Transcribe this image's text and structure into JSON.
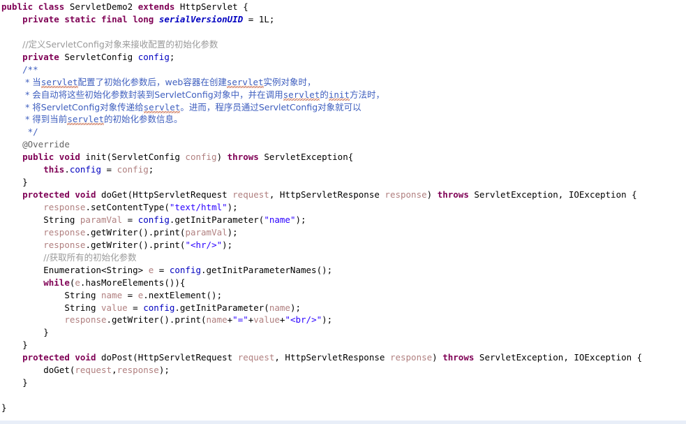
{
  "editor": {
    "language": "Java",
    "class_name": "ServletDemo2",
    "background_color": "#ffffff",
    "bottom_band_color": "#e8eef8",
    "colors": {
      "keyword": "#7f0055",
      "string": "#2a00ff",
      "line_comment": "#9a9a9a",
      "javadoc": "#3f5fbf",
      "field": "#0000c0",
      "local_variable": "#b07f7f",
      "annotation": "#646464",
      "plain_text": "#000000",
      "spellcheck_squiggle": "#c0502a"
    },
    "lines": [
      {
        "n": 1,
        "indent": 0,
        "tokens": [
          {
            "t": "public",
            "c": "kw"
          },
          {
            "t": " ",
            "c": "plain"
          },
          {
            "t": "class",
            "c": "kw"
          },
          {
            "t": " ServletDemo2 ",
            "c": "plain"
          },
          {
            "t": "extends",
            "c": "kw"
          },
          {
            "t": " HttpServlet {",
            "c": "plain"
          }
        ]
      },
      {
        "n": 2,
        "indent": 1,
        "tokens": [
          {
            "t": "private",
            "c": "kw"
          },
          {
            "t": " ",
            "c": "plain"
          },
          {
            "t": "static",
            "c": "kw"
          },
          {
            "t": " ",
            "c": "plain"
          },
          {
            "t": "final",
            "c": "kw"
          },
          {
            "t": " ",
            "c": "plain"
          },
          {
            "t": "long",
            "c": "kw"
          },
          {
            "t": " ",
            "c": "plain"
          },
          {
            "t": "serialVersionUID",
            "c": "fielditalic"
          },
          {
            "t": " = 1L;",
            "c": "plain"
          }
        ]
      },
      {
        "n": 3,
        "indent": 0,
        "tokens": []
      },
      {
        "n": 4,
        "indent": 1,
        "tokens": [
          {
            "t": "//定义ServletConfig对象来接收配置的初始化参数",
            "c": "cmt"
          }
        ]
      },
      {
        "n": 5,
        "indent": 1,
        "tokens": [
          {
            "t": "private",
            "c": "kw"
          },
          {
            "t": " ServletConfig ",
            "c": "plain"
          },
          {
            "t": "config",
            "c": "field"
          },
          {
            "t": ";",
            "c": "plain"
          }
        ]
      },
      {
        "n": 6,
        "indent": 1,
        "tokens": [
          {
            "t": "/**",
            "c": "jdoc"
          }
        ]
      },
      {
        "n": 7,
        "indent": 1,
        "tokens": [
          {
            "t": " * 当",
            "c": "jdoc"
          },
          {
            "t": "servlet",
            "c": "jdoc",
            "sq": true
          },
          {
            "t": "配置了初始化参数后，web容器在创建",
            "c": "jdoc"
          },
          {
            "t": "servlet",
            "c": "jdoc",
            "sq": true
          },
          {
            "t": "实例对象时，",
            "c": "jdoc"
          }
        ]
      },
      {
        "n": 8,
        "indent": 1,
        "tokens": [
          {
            "t": " * 会自动将这些初始化参数封装到ServletConfig对象中，并在调用",
            "c": "jdoc"
          },
          {
            "t": "servlet",
            "c": "jdoc",
            "sq": true
          },
          {
            "t": "的",
            "c": "jdoc"
          },
          {
            "t": "init",
            "c": "jdoc",
            "sq": true
          },
          {
            "t": "方法时，",
            "c": "jdoc"
          }
        ]
      },
      {
        "n": 9,
        "indent": 1,
        "tokens": [
          {
            "t": " * 将ServletConfig对象传递给",
            "c": "jdoc"
          },
          {
            "t": "servlet",
            "c": "jdoc",
            "sq": true
          },
          {
            "t": "。进而，程序员通过ServletConfig对象就可以",
            "c": "jdoc"
          }
        ]
      },
      {
        "n": 10,
        "indent": 1,
        "tokens": [
          {
            "t": " * 得到当前",
            "c": "jdoc"
          },
          {
            "t": "servlet",
            "c": "jdoc",
            "sq": true
          },
          {
            "t": "的初始化参数信息。",
            "c": "jdoc"
          }
        ]
      },
      {
        "n": 11,
        "indent": 1,
        "tokens": [
          {
            "t": " */",
            "c": "jdoc"
          }
        ]
      },
      {
        "n": 12,
        "indent": 1,
        "tokens": [
          {
            "t": "@Override",
            "c": "anno"
          }
        ]
      },
      {
        "n": 13,
        "indent": 1,
        "tokens": [
          {
            "t": "public",
            "c": "kw"
          },
          {
            "t": " ",
            "c": "plain"
          },
          {
            "t": "void",
            "c": "kw"
          },
          {
            "t": " init(ServletConfig ",
            "c": "plain"
          },
          {
            "t": "config",
            "c": "local"
          },
          {
            "t": ") ",
            "c": "plain"
          },
          {
            "t": "throws",
            "c": "kw"
          },
          {
            "t": " ServletException{",
            "c": "plain"
          }
        ]
      },
      {
        "n": 14,
        "indent": 2,
        "tokens": [
          {
            "t": "this",
            "c": "kw"
          },
          {
            "t": ".",
            "c": "plain"
          },
          {
            "t": "config",
            "c": "field"
          },
          {
            "t": " = ",
            "c": "plain"
          },
          {
            "t": "config",
            "c": "local"
          },
          {
            "t": ";",
            "c": "plain"
          }
        ]
      },
      {
        "n": 15,
        "indent": 1,
        "tokens": [
          {
            "t": "}",
            "c": "plain"
          }
        ]
      },
      {
        "n": 16,
        "indent": 1,
        "tokens": [
          {
            "t": "protected",
            "c": "kw"
          },
          {
            "t": " ",
            "c": "plain"
          },
          {
            "t": "void",
            "c": "kw"
          },
          {
            "t": " doGet(HttpServletRequest ",
            "c": "plain"
          },
          {
            "t": "request",
            "c": "local"
          },
          {
            "t": ", HttpServletResponse ",
            "c": "plain"
          },
          {
            "t": "response",
            "c": "local"
          },
          {
            "t": ") ",
            "c": "plain"
          },
          {
            "t": "throws",
            "c": "kw"
          },
          {
            "t": " ServletException, IOException {",
            "c": "plain"
          }
        ]
      },
      {
        "n": 17,
        "indent": 2,
        "tokens": [
          {
            "t": "response",
            "c": "local"
          },
          {
            "t": ".setContentType(",
            "c": "plain"
          },
          {
            "t": "\"text/html\"",
            "c": "str"
          },
          {
            "t": ");",
            "c": "plain"
          }
        ]
      },
      {
        "n": 18,
        "indent": 2,
        "tokens": [
          {
            "t": "String ",
            "c": "plain"
          },
          {
            "t": "paramVal",
            "c": "local"
          },
          {
            "t": " = ",
            "c": "plain"
          },
          {
            "t": "config",
            "c": "field"
          },
          {
            "t": ".getInitParameter(",
            "c": "plain"
          },
          {
            "t": "\"name\"",
            "c": "str"
          },
          {
            "t": ");",
            "c": "plain"
          }
        ]
      },
      {
        "n": 19,
        "indent": 2,
        "tokens": [
          {
            "t": "response",
            "c": "local"
          },
          {
            "t": ".getWriter().print(",
            "c": "plain"
          },
          {
            "t": "paramVal",
            "c": "local"
          },
          {
            "t": ");",
            "c": "plain"
          }
        ]
      },
      {
        "n": 20,
        "indent": 2,
        "tokens": [
          {
            "t": "response",
            "c": "local"
          },
          {
            "t": ".getWriter().print(",
            "c": "plain"
          },
          {
            "t": "\"<hr/>\"",
            "c": "str"
          },
          {
            "t": ");",
            "c": "plain"
          }
        ]
      },
      {
        "n": 21,
        "indent": 2,
        "tokens": [
          {
            "t": "//获取所有的初始化参数",
            "c": "cmt"
          }
        ]
      },
      {
        "n": 22,
        "indent": 2,
        "tokens": [
          {
            "t": "Enumeration<String> ",
            "c": "plain"
          },
          {
            "t": "e",
            "c": "local"
          },
          {
            "t": " = ",
            "c": "plain"
          },
          {
            "t": "config",
            "c": "field"
          },
          {
            "t": ".getInitParameterNames();",
            "c": "plain"
          }
        ]
      },
      {
        "n": 23,
        "indent": 2,
        "tokens": [
          {
            "t": "while",
            "c": "kw"
          },
          {
            "t": "(",
            "c": "plain"
          },
          {
            "t": "e",
            "c": "local"
          },
          {
            "t": ".hasMoreElements()){",
            "c": "plain"
          }
        ]
      },
      {
        "n": 24,
        "indent": 3,
        "tokens": [
          {
            "t": "String ",
            "c": "plain"
          },
          {
            "t": "name",
            "c": "local"
          },
          {
            "t": " = ",
            "c": "plain"
          },
          {
            "t": "e",
            "c": "local"
          },
          {
            "t": ".nextElement();",
            "c": "plain"
          }
        ]
      },
      {
        "n": 25,
        "indent": 3,
        "tokens": [
          {
            "t": "String ",
            "c": "plain"
          },
          {
            "t": "value",
            "c": "local"
          },
          {
            "t": " = ",
            "c": "plain"
          },
          {
            "t": "config",
            "c": "field"
          },
          {
            "t": ".getInitParameter(",
            "c": "plain"
          },
          {
            "t": "name",
            "c": "local"
          },
          {
            "t": ");",
            "c": "plain"
          }
        ]
      },
      {
        "n": 26,
        "indent": 3,
        "tokens": [
          {
            "t": "response",
            "c": "local"
          },
          {
            "t": ".getWriter().print(",
            "c": "plain"
          },
          {
            "t": "name",
            "c": "local"
          },
          {
            "t": "+",
            "c": "plain"
          },
          {
            "t": "\"=\"",
            "c": "str"
          },
          {
            "t": "+",
            "c": "plain"
          },
          {
            "t": "value",
            "c": "local"
          },
          {
            "t": "+",
            "c": "plain"
          },
          {
            "t": "\"<br/>\"",
            "c": "str"
          },
          {
            "t": ");",
            "c": "plain"
          }
        ]
      },
      {
        "n": 27,
        "indent": 2,
        "tokens": [
          {
            "t": "}",
            "c": "plain"
          }
        ]
      },
      {
        "n": 28,
        "indent": 1,
        "tokens": [
          {
            "t": "}",
            "c": "plain"
          }
        ]
      },
      {
        "n": 29,
        "indent": 1,
        "tokens": [
          {
            "t": "protected",
            "c": "kw"
          },
          {
            "t": " ",
            "c": "plain"
          },
          {
            "t": "void",
            "c": "kw"
          },
          {
            "t": " doPost(HttpServletRequest ",
            "c": "plain"
          },
          {
            "t": "request",
            "c": "local"
          },
          {
            "t": ", HttpServletResponse ",
            "c": "plain"
          },
          {
            "t": "response",
            "c": "local"
          },
          {
            "t": ") ",
            "c": "plain"
          },
          {
            "t": "throws",
            "c": "kw"
          },
          {
            "t": " ServletException, IOException {",
            "c": "plain"
          }
        ]
      },
      {
        "n": 30,
        "indent": 2,
        "tokens": [
          {
            "t": "doGet(",
            "c": "plain"
          },
          {
            "t": "request",
            "c": "local"
          },
          {
            "t": ",",
            "c": "plain"
          },
          {
            "t": "response",
            "c": "local"
          },
          {
            "t": ");",
            "c": "plain"
          }
        ]
      },
      {
        "n": 31,
        "indent": 1,
        "tokens": [
          {
            "t": "}",
            "c": "plain"
          }
        ]
      },
      {
        "n": 32,
        "indent": 0,
        "tokens": []
      },
      {
        "n": 33,
        "indent": 0,
        "tokens": [
          {
            "t": "}",
            "c": "plain"
          }
        ]
      }
    ]
  }
}
